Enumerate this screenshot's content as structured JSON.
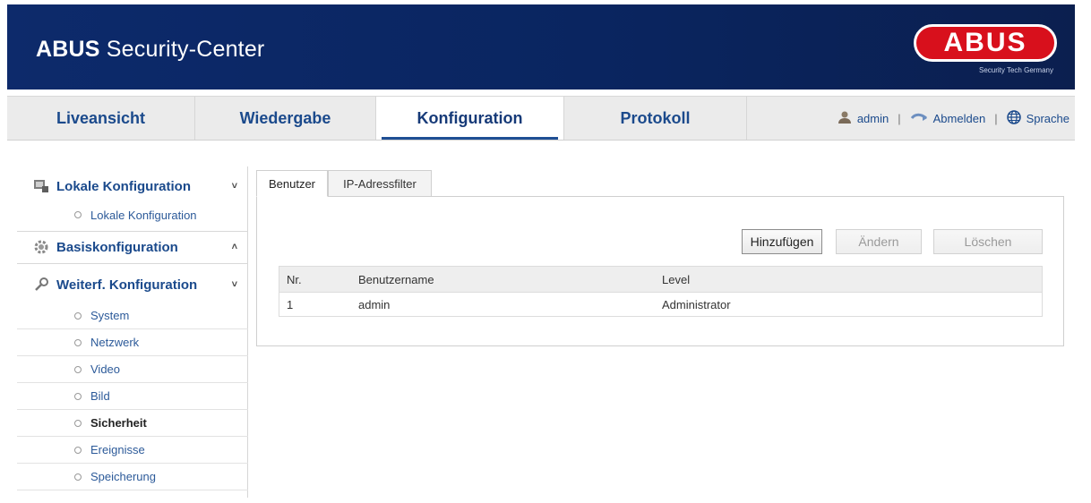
{
  "header": {
    "title_bold": "ABUS",
    "title_rest": " Security-Center",
    "logo_text": "ABUS",
    "logo_tagline": "Security Tech Germany",
    "brand_color": "#0d2a6b",
    "logo_color": "#d8101c"
  },
  "nav": {
    "tabs": [
      {
        "label": "Liveansicht"
      },
      {
        "label": "Wiedergabe"
      },
      {
        "label": "Konfiguration"
      },
      {
        "label": "Protokoll"
      }
    ],
    "user": {
      "name": "admin",
      "icon": "user-icon"
    },
    "logout": {
      "label": "Abmelden",
      "icon": "logout-icon"
    },
    "language": {
      "label": "Sprache",
      "icon": "globe-icon"
    },
    "separator": "|"
  },
  "sidebar": {
    "sections": [
      {
        "label": "Lokale Konfiguration",
        "icon": "monitor-icon",
        "chevron": "˅"
      },
      {
        "label": "Basiskonfiguration",
        "icon": "gear-icon",
        "chevron": "˄"
      },
      {
        "label": "Weiterf. Konfiguration",
        "icon": "wrench-icon",
        "chevron": "˅"
      }
    ],
    "local_items": [
      {
        "label": "Lokale Konfiguration"
      }
    ],
    "advanced_items": [
      {
        "label": "System"
      },
      {
        "label": "Netzwerk"
      },
      {
        "label": "Video"
      },
      {
        "label": "Bild"
      },
      {
        "label": "Sicherheit",
        "active": true
      },
      {
        "label": "Ereignisse"
      },
      {
        "label": "Speicherung"
      }
    ]
  },
  "content": {
    "tabs": [
      {
        "label": "Benutzer",
        "active": true
      },
      {
        "label": "IP-Adressfilter"
      }
    ],
    "buttons": {
      "add": "Hinzufügen",
      "edit": "Ändern",
      "delete": "Löschen"
    },
    "table": {
      "headers": [
        "Nr.",
        "Benutzername",
        "Level"
      ],
      "rows": [
        {
          "nr": "1",
          "username": "admin",
          "level": "Administrator"
        }
      ]
    }
  }
}
